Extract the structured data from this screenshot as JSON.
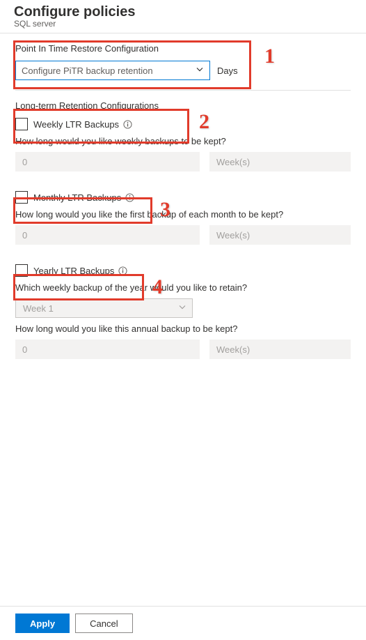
{
  "header": {
    "title": "Configure policies",
    "subtitle": "SQL server"
  },
  "pitr": {
    "heading": "Point In Time Restore Configuration",
    "dropdown_placeholder": "Configure PiTR backup retention",
    "unit": "Days"
  },
  "ltr": {
    "heading": "Long-term Retention Configurations",
    "weekly": {
      "label": "Weekly LTR Backups",
      "question": "How long would you like weekly backups to be kept?",
      "value": "0",
      "unit": "Week(s)"
    },
    "monthly": {
      "label": "Monthly LTR Backups",
      "question": "How long would you like the first backup of each month to be kept?",
      "value": "0",
      "unit": "Week(s)"
    },
    "yearly": {
      "label": "Yearly LTR Backups",
      "which_question": "Which weekly backup of the year would you like to retain?",
      "which_value": "Week 1",
      "duration_question": "How long would you like this annual backup to be kept?",
      "value": "0",
      "unit": "Week(s)"
    }
  },
  "footer": {
    "apply": "Apply",
    "cancel": "Cancel"
  },
  "annotations": {
    "n1": "1",
    "n2": "2",
    "n3": "3",
    "n4": "4"
  }
}
